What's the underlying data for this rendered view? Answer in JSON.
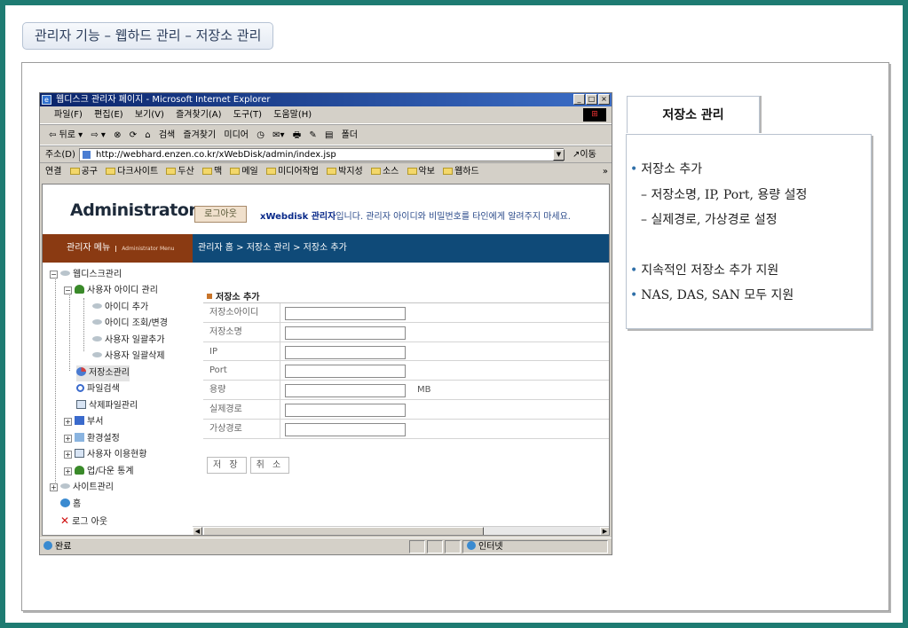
{
  "page_title": "관리자 기능 – 웹하드 관리 – 저장소 관리",
  "browser": {
    "title": "웹디스크 관리자 페이지 - Microsoft Internet Explorer",
    "window_buttons": [
      "_",
      "□",
      "×"
    ],
    "menu": [
      "파일(F)",
      "편집(E)",
      "보기(V)",
      "즐겨찾기(A)",
      "도구(T)",
      "도움말(H)"
    ],
    "toolbar": [
      "⇦ 뒤로 ▾",
      "⇨ ▾",
      "⊗",
      "⟳",
      "⌂",
      "검색",
      "즐겨찾기",
      "미디어",
      "◷",
      "✉▾",
      "🖶",
      "✎",
      "▤",
      "폴더"
    ],
    "address_label": "주소(D)",
    "address_url": "http://webhard.enzen.co.kr/xWebDisk/admin/index.jsp",
    "go_label": "이동",
    "links_label": "연결",
    "links": [
      "공구",
      "다크사이트",
      "두산",
      "맥",
      "메일",
      "미디어작업",
      "박지성",
      "소스",
      "악보",
      "웹하드"
    ],
    "status_text": "완료",
    "zone_text": "인터넷"
  },
  "webpage": {
    "logo": "Administrator",
    "logout_label": "로그아웃",
    "notice_brand": "xWebdisk 관리자",
    "notice_text": "입니다. 관리자 아이디와 비밀번호를 타인에게 알려주지 마세요.",
    "sidebar_title": "관리자 메뉴",
    "sidebar_subtitle": "Administrator Menu",
    "breadcrumb": "관리자 홈 > 저장소 관리 > 저장소 추가",
    "tree": {
      "webdisk": "웹디스크관리",
      "user_id_mgmt": "사용자 아이디 관리",
      "id_add": "아이디 추가",
      "id_view_change": "아이디 조회/변경",
      "user_bulk_add": "사용자 일괄추가",
      "user_bulk_delete": "사용자 일괄삭제",
      "storage_mgmt": "저장소관리",
      "file_search": "파일검색",
      "deleted_files": "삭제파일관리",
      "department": "부서",
      "settings": "환경설정",
      "user_usage": "사용자 이용현황",
      "updown_stats": "업/다운 통계",
      "site_mgmt": "사이트관리",
      "home": "홈",
      "logout": "로그 아웃"
    },
    "form": {
      "title": "저장소 추가",
      "fields": [
        {
          "label": "저장소아이디",
          "value": ""
        },
        {
          "label": "저장소명",
          "value": ""
        },
        {
          "label": "IP",
          "value": ""
        },
        {
          "label": "Port",
          "value": ""
        },
        {
          "label": "용량",
          "value": "",
          "unit": "MB"
        },
        {
          "label": "실제경로",
          "value": ""
        },
        {
          "label": "가상경로",
          "value": ""
        }
      ],
      "save_label": "저 장",
      "cancel_label": "취 소"
    }
  },
  "panel": {
    "title": "저장소 관리",
    "bullets": [
      "저장소 추가",
      "– 저장소명, IP, Port, 용량 설정",
      "– 실제경로, 가상경로 설정",
      "지속적인 저장소 추가 지원",
      "NAS, DAS, SAN 모두 지원"
    ]
  }
}
